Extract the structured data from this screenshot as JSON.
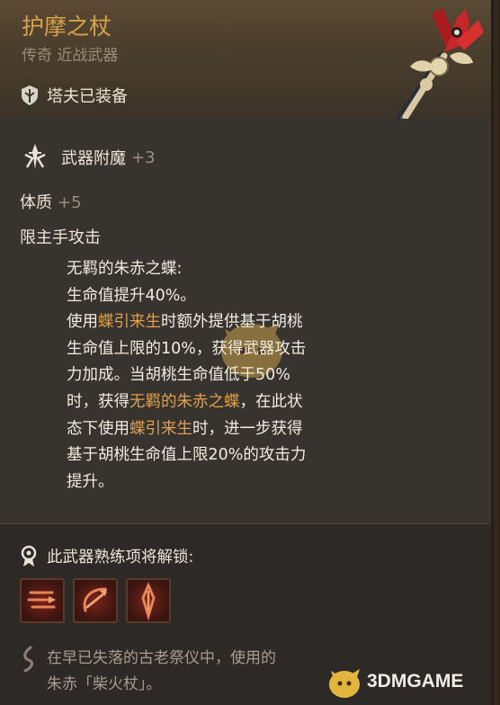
{
  "item": {
    "name": "护摩之杖",
    "rarity_type": "传奇 近战武器",
    "equipped_by": "塔夫已装备"
  },
  "enchant": {
    "label": "武器附魔",
    "value": "+3"
  },
  "stat": {
    "label": "体质",
    "value": "+5"
  },
  "restriction": "限主手攻击",
  "description": {
    "l1": "无羁的朱赤之蝶:",
    "l2": "生命值提升40%。",
    "l3a": "使用",
    "l3b": "蝶引来生",
    "l3c": "时额外提供基于胡桃",
    "l4": "生命值上限的10%，获得武器攻击",
    "l5": "力加成。当胡桃生命值低于50%",
    "l6a": "时，获得",
    "l6b": "无羁的朱赤之蝶",
    "l6c": "，在此状",
    "l7a": "态下使用",
    "l7b": "蝶引来生",
    "l7c": "时，进一步获得",
    "l8": "基于胡桃生命值上限20%的攻击力",
    "l9": "提升。"
  },
  "mastery": {
    "label": "此武器熟练项将解锁:"
  },
  "lore": {
    "l1": "在早已失落的古老祭仪中，使用的",
    "l2": "朱赤「柴火杖」。"
  },
  "watermark": {
    "text": "3DMGAME"
  },
  "colors": {
    "title": "#d8a34a",
    "highlight": "#e0a04c",
    "muted": "#9a8e80"
  },
  "icons": {
    "equip": "shield-icon",
    "enchant": "enchant-icon",
    "mastery": "mastery-icon",
    "lore": "quill-icon"
  }
}
